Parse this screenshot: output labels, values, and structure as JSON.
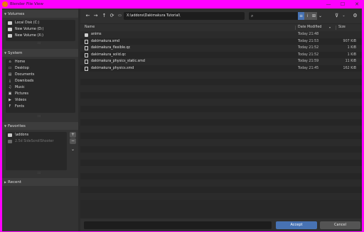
{
  "window": {
    "title": "Blender File View",
    "minimize": "—",
    "maximize": "☐",
    "close": "✕"
  },
  "sidebar": {
    "volumes": {
      "header": "Volumes",
      "items": [
        {
          "label": "Local Disk (C:)",
          "icon": "drive-icon"
        },
        {
          "label": "New Volume (D:)",
          "icon": "drive-icon"
        },
        {
          "label": "New Volume (X:)",
          "icon": "drive-icon"
        }
      ]
    },
    "system": {
      "header": "System",
      "items": [
        {
          "label": "Home",
          "icon": "home-icon",
          "glyph": "⌂"
        },
        {
          "label": "Desktop",
          "icon": "desktop-icon",
          "glyph": "▭"
        },
        {
          "label": "Documents",
          "icon": "documents-icon",
          "glyph": "▤"
        },
        {
          "label": "Downloads",
          "icon": "download-icon",
          "glyph": "⤓"
        },
        {
          "label": "Music",
          "icon": "music-icon",
          "glyph": "♫"
        },
        {
          "label": "Pictures",
          "icon": "pictures-icon",
          "glyph": "▣"
        },
        {
          "label": "Videos",
          "icon": "videos-icon",
          "glyph": "▶"
        },
        {
          "label": "Fonts",
          "icon": "fonts-icon",
          "glyph": "F"
        }
      ]
    },
    "favorites": {
      "header": "Favorites",
      "items": [
        {
          "label": "\\addons",
          "icon": "folder-icon",
          "dim": false
        },
        {
          "label": "2.5d SideScrollShooter",
          "icon": "folder-icon",
          "dim": true
        }
      ],
      "add": "+",
      "remove": "−",
      "more": "⌄"
    },
    "recent": {
      "header": "Recent"
    }
  },
  "toolbar": {
    "back": "←",
    "forward": "→",
    "parent": "↑",
    "refresh": "⟳",
    "new_folder": "▭",
    "path": "X:\\addons\\Dakimakura Tutorial\\",
    "search_placeholder": "",
    "search_icon": "⌕",
    "view_icons": [
      "≡",
      "⁞",
      "⊞",
      "⌄"
    ],
    "filter": "⊽",
    "filter_arrow": "⌄",
    "settings": "⚙"
  },
  "columns": {
    "name": "Name",
    "date": "Date Modified",
    "size": "Size"
  },
  "files": [
    {
      "name": "anims",
      "type": "folder",
      "date": "Today 21:48",
      "size": ""
    },
    {
      "name": "dakimakura.smd",
      "type": "file",
      "date": "Today 21:53",
      "size": "907 KiB"
    },
    {
      "name": "dakimakura_flexible.qc",
      "type": "file",
      "date": "Today 21:52",
      "size": "1 KiB"
    },
    {
      "name": "dakimakura_solid.qc",
      "type": "file",
      "date": "Today 21:52",
      "size": "1 KiB"
    },
    {
      "name": "dakimakura_physics_static.smd",
      "type": "file",
      "date": "Today 21:59",
      "size": "11 KiB"
    },
    {
      "name": "dakimakura_physics.smd",
      "type": "file",
      "date": "Today 21:45",
      "size": "162 KiB"
    }
  ],
  "bottom": {
    "filename": "",
    "accept": "Accept",
    "cancel": "Cancel"
  },
  "colors": {
    "accent": "#4772b3",
    "titlebar": "#ff00ff"
  }
}
